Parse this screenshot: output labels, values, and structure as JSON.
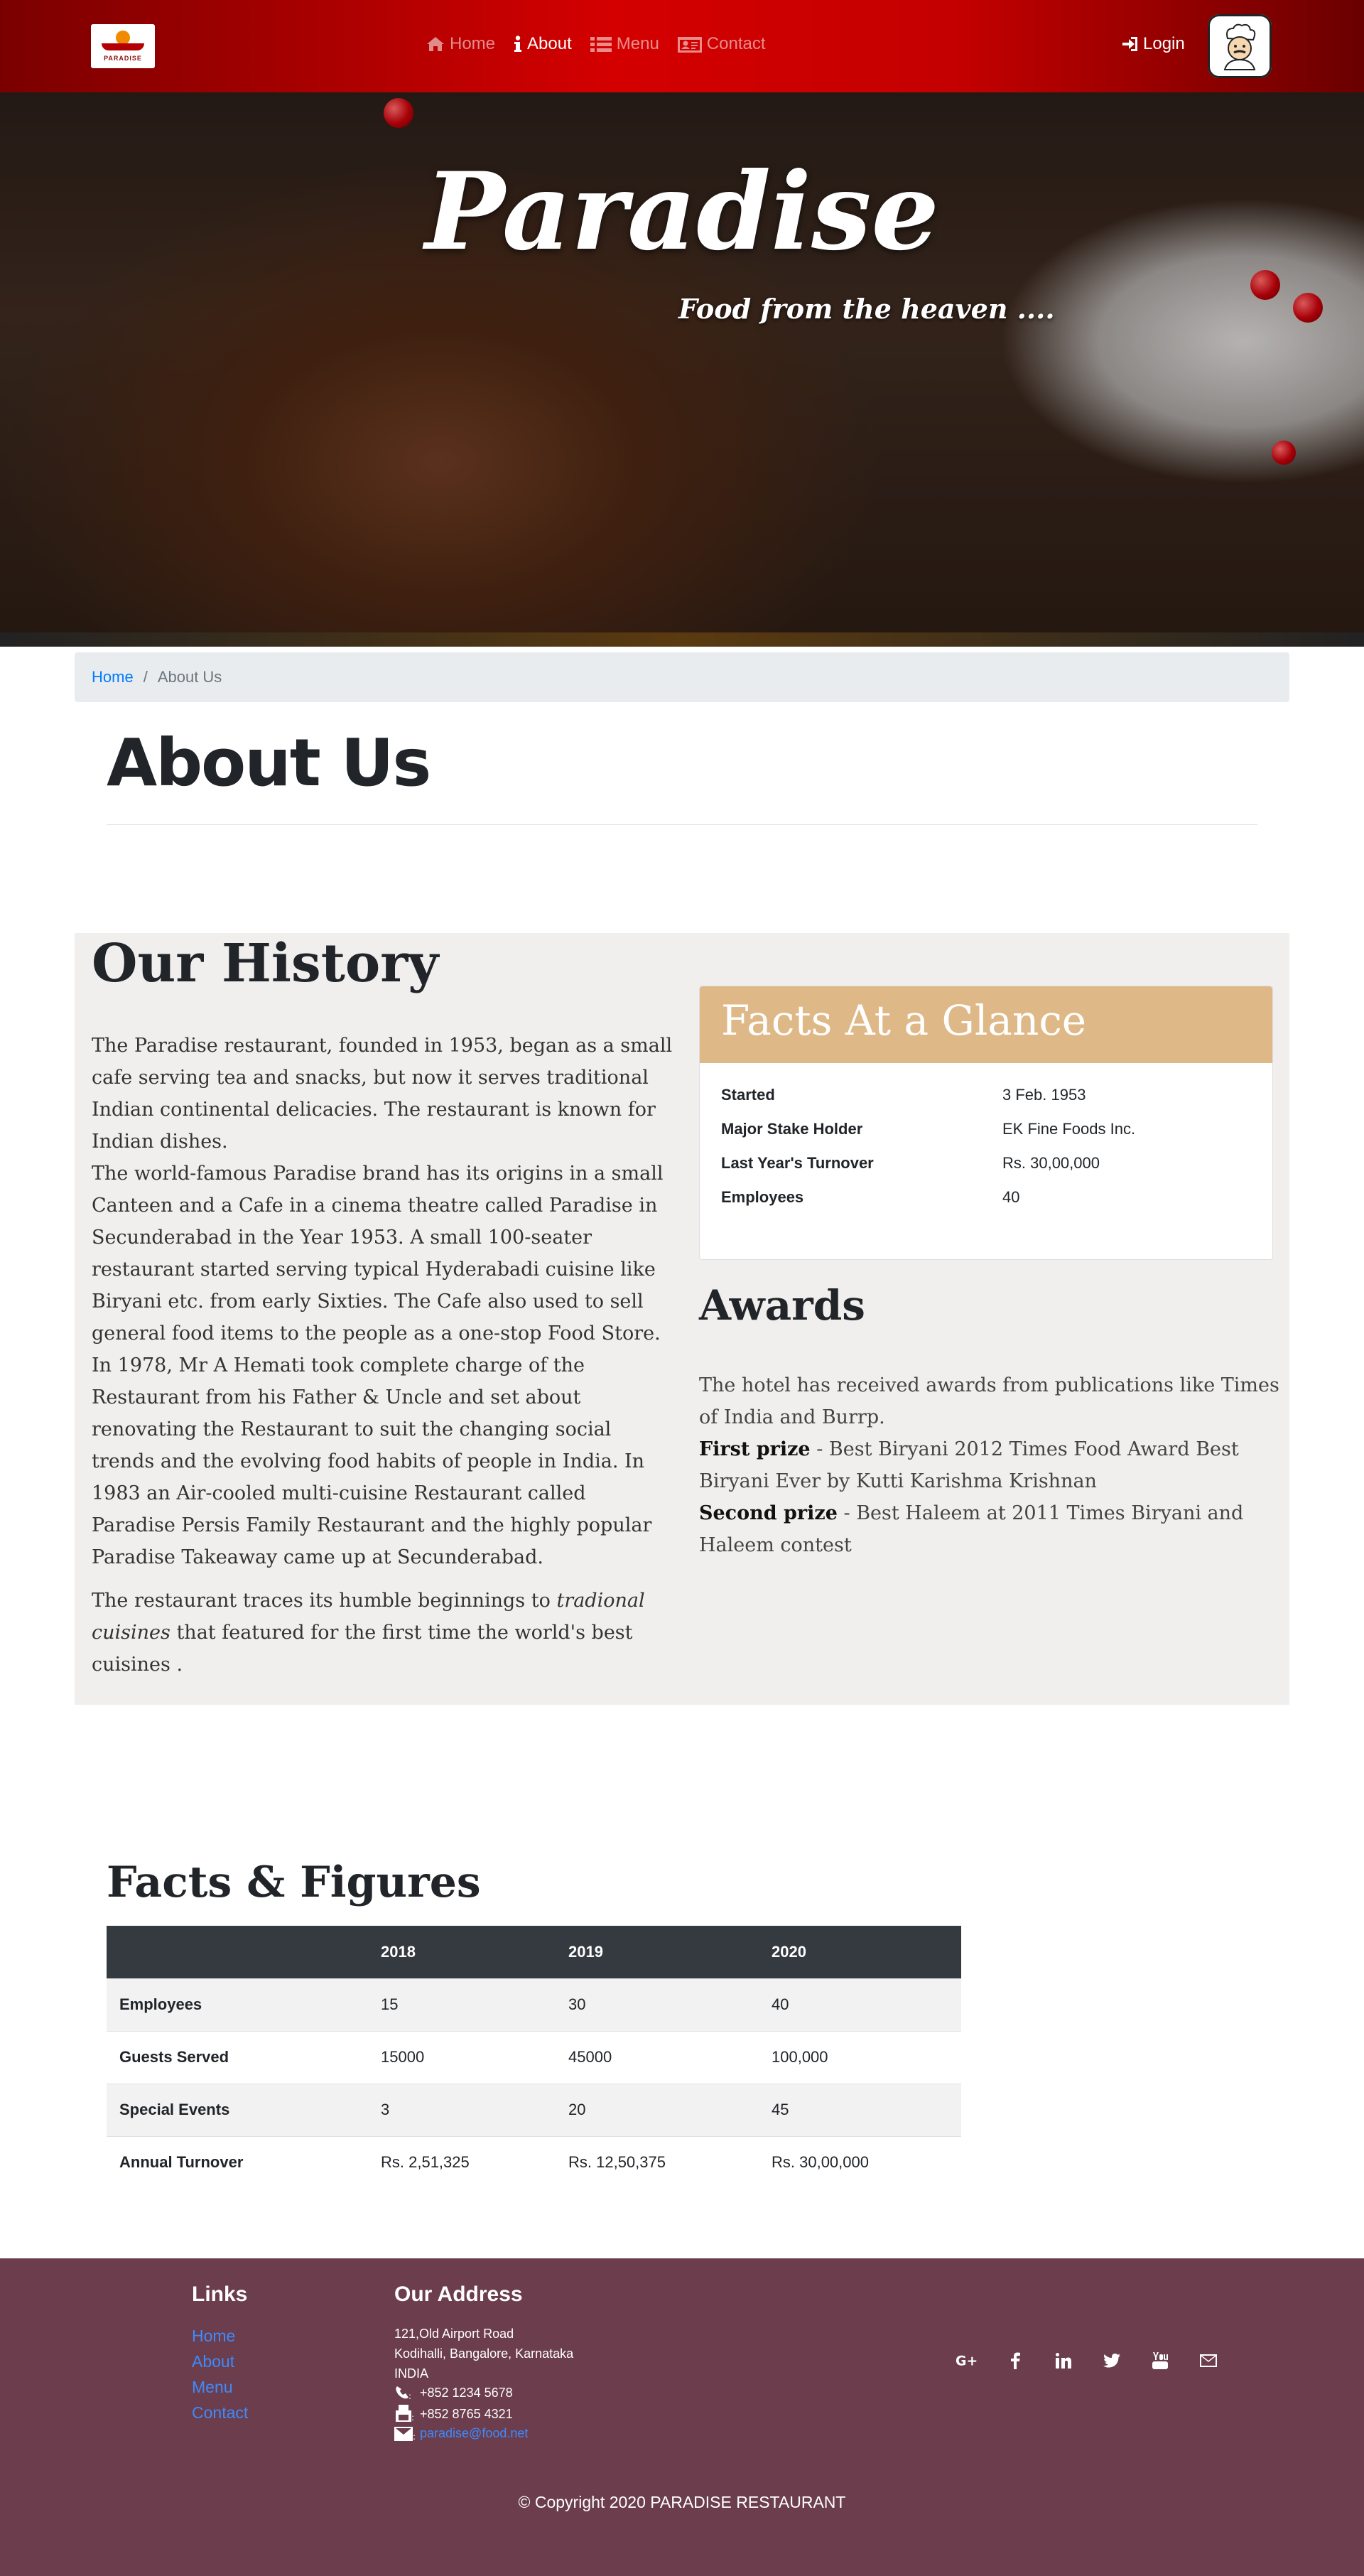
{
  "brand": {
    "logo_text": "PARADISE"
  },
  "nav": {
    "items": [
      {
        "label": "Home",
        "icon": "home-icon",
        "active": false
      },
      {
        "label": "About",
        "icon": "info-icon",
        "active": true
      },
      {
        "label": "Menu",
        "icon": "list-icon",
        "active": false
      },
      {
        "label": "Contact",
        "icon": "address-card-icon",
        "active": false
      }
    ],
    "login_label": "Login"
  },
  "hero": {
    "title": "Paradise",
    "subtitle": "Food from the heaven ...."
  },
  "breadcrumb": {
    "home": "Home",
    "separator": "/",
    "current": "About Us"
  },
  "page": {
    "title": "About Us"
  },
  "history": {
    "title": "Our History",
    "paragraphs": [
      "The Paradise restaurant, founded in 1953, began as a small cafe serving tea and snacks, but now it serves traditional Indian continental delicacies. The restaurant is known for Indian dishes.",
      "The world-famous Paradise brand has its origins in a small Canteen and a Cafe in a cinema theatre called Paradise in Secunderabad in the Year 1953. A small 100-seater restaurant started serving typical Hyderabadi cuisine like Biryani etc. from early Sixties. The Cafe also used to sell general food items to the people as a one-stop Food Store.",
      "In 1978, Mr A Hemati took complete charge of the Restaurant from his Father & Uncle and set about renovating the Restaurant to suit the changing social trends and the evolving food habits of people in India. In 1983 an Air-cooled multi-cuisine Restaurant called Paradise Persis Family Restaurant and the highly popular Paradise Takeaway came up at Secunderabad."
    ],
    "closing_before": "The restaurant traces its humble beginnings to ",
    "closing_italic": "tradional cuisines",
    "closing_after": " that featured for the first time the world's best cuisines ."
  },
  "facts": {
    "title": "Facts At a Glance",
    "rows": [
      {
        "key": "Started",
        "value": "3 Feb. 1953"
      },
      {
        "key": "Major Stake Holder",
        "value": "EK Fine Foods Inc."
      },
      {
        "key": "Last Year's Turnover",
        "value": "Rs. 30,00,000"
      },
      {
        "key": "Employees",
        "value": "40"
      }
    ]
  },
  "awards": {
    "title": "Awards",
    "intro": "The hotel has received awards from publications like Times of India and Burrp.",
    "items": [
      {
        "label": "First prize",
        "text": " - Best Biryani 2012 Times Food Award Best Biryani Ever by Kutti Karishma Krishnan"
      },
      {
        "label": "Second prize",
        "text": " - Best Haleem at 2011 Times Biryani and Haleem contest"
      }
    ]
  },
  "figures": {
    "title": "Facts & Figures",
    "columns": [
      "",
      "2018",
      "2019",
      "2020"
    ],
    "rows": [
      [
        "Employees",
        "15",
        "30",
        "40"
      ],
      [
        "Guests Served",
        "15000",
        "45000",
        "100,000"
      ],
      [
        "Special Events",
        "3",
        "20",
        "45"
      ],
      [
        "Annual Turnover",
        "Rs. 2,51,325",
        "Rs. 12,50,375",
        "Rs. 30,00,000"
      ]
    ]
  },
  "footer": {
    "links_title": "Links",
    "links": [
      "Home",
      "About",
      "Menu",
      "Contact"
    ],
    "address_title": "Our Address",
    "address_lines": [
      "121,Old Airport Road",
      "Kodihalli, Bangalore, Karnataka",
      "INDIA"
    ],
    "phone": "+852 1234 5678",
    "fax": "+852 8765 4321",
    "email": "paradise@food.net",
    "socials": [
      "google-plus-icon",
      "facebook-icon",
      "linkedin-icon",
      "twitter-icon",
      "youtube-icon",
      "envelope-icon"
    ],
    "copyright": "© Copyright 2020 PARADISE RESTAURANT"
  }
}
